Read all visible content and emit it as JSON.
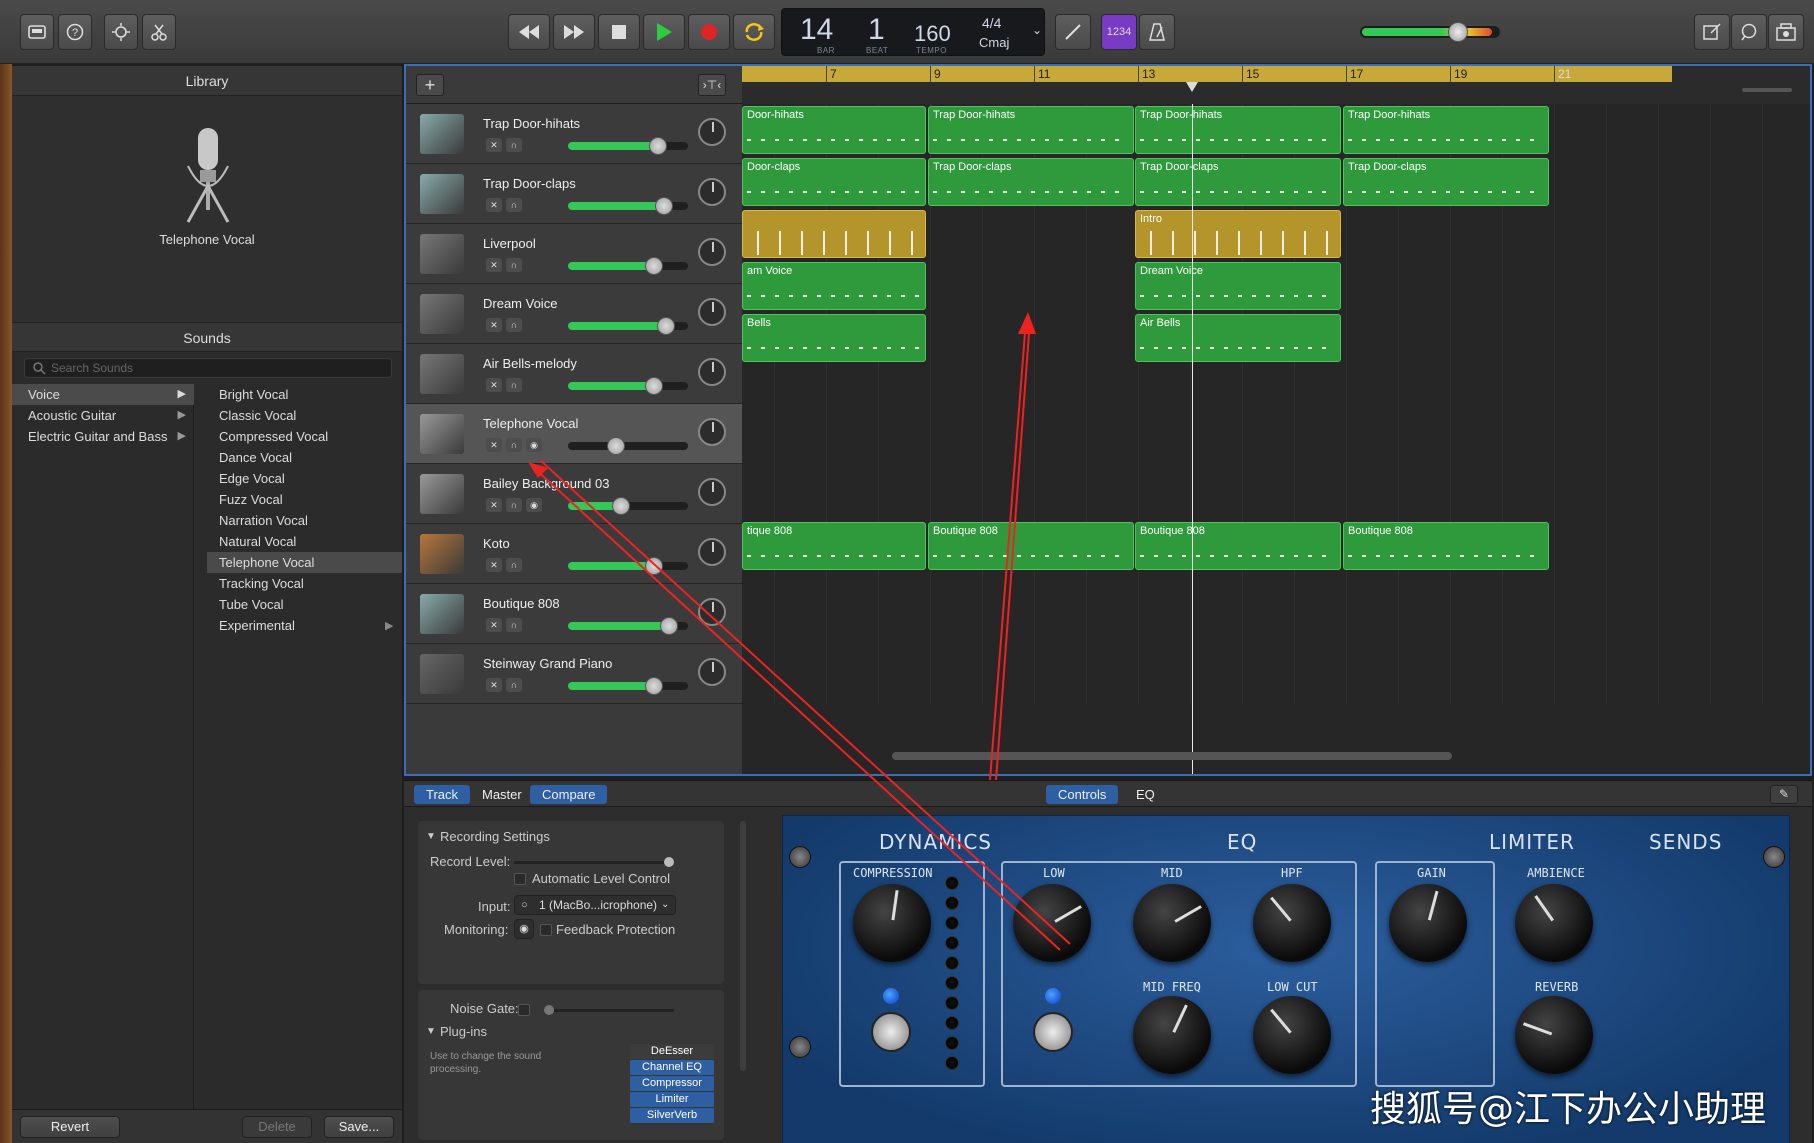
{
  "toolbar": {
    "lcd": {
      "bar": "14",
      "beat": "1",
      "bar_label": "BAR",
      "beat_label": "BEAT",
      "tempo": "160",
      "tempo_label": "TEMPO",
      "signature": "4/4",
      "key": "Cmaj"
    },
    "count_in": "1234",
    "icons": [
      "library-icon",
      "help-icon",
      "smart-controls-icon",
      "scissors-icon",
      "rewind-icon",
      "fast-forward-icon",
      "stop-icon",
      "play-icon",
      "record-icon",
      "cycle-icon",
      "tuner-icon",
      "count-in-icon",
      "metronome-icon",
      "notepad-icon",
      "loops-icon",
      "media-icon"
    ]
  },
  "library": {
    "title": "Library",
    "preview_name": "Telephone Vocal",
    "sounds_header": "Sounds",
    "search_placeholder": "Search Sounds",
    "categories": [
      {
        "label": "Voice",
        "selected": true
      },
      {
        "label": "Acoustic Guitar",
        "selected": false
      },
      {
        "label": "Electric Guitar and Bass",
        "selected": false
      }
    ],
    "patches": [
      {
        "label": "Bright Vocal"
      },
      {
        "label": "Classic Vocal"
      },
      {
        "label": "Compressed Vocal"
      },
      {
        "label": "Dance Vocal"
      },
      {
        "label": "Edge Vocal"
      },
      {
        "label": "Fuzz Vocal"
      },
      {
        "label": "Narration Vocal"
      },
      {
        "label": "Natural Vocal"
      },
      {
        "label": "Telephone Vocal"
      },
      {
        "label": "Tracking Vocal"
      },
      {
        "label": "Tube Vocal"
      },
      {
        "label": "Experimental"
      }
    ],
    "buttons": {
      "revert": "Revert",
      "delete": "Delete",
      "save": "Save..."
    }
  },
  "ruler": {
    "bars": [
      "7",
      "9",
      "11",
      "13",
      "15",
      "17",
      "19",
      "21"
    ]
  },
  "tracks": [
    {
      "name": "Trap Door-hihats",
      "volume": 0.75,
      "selected": false
    },
    {
      "name": "Trap Door-claps",
      "volume": 0.8,
      "selected": false
    },
    {
      "name": "Liverpool",
      "volume": 0.72,
      "selected": false
    },
    {
      "name": "Dream Voice",
      "volume": 0.82,
      "selected": false
    },
    {
      "name": "Air Bells-melody",
      "volume": 0.72,
      "selected": false
    },
    {
      "name": "Telephone Vocal",
      "volume": 0.4,
      "selected": true
    },
    {
      "name": "Bailey Background 03",
      "volume": 0.44,
      "selected": false
    },
    {
      "name": "Koto",
      "volume": 0.72,
      "selected": false
    },
    {
      "name": "Boutique 808",
      "volume": 0.84,
      "selected": false
    },
    {
      "name": "Steinway Grand Piano",
      "volume": 0.72,
      "selected": false
    }
  ],
  "regions": [
    {
      "row": 0,
      "label": "Door-hihats",
      "color": "g"
    },
    {
      "row": 0,
      "label": "Trap Door-hihats",
      "color": "g"
    },
    {
      "row": 0,
      "label": "Trap Door-hihats",
      "color": "g"
    },
    {
      "row": 0,
      "label": "Trap Door-hihats",
      "color": "g"
    },
    {
      "row": 1,
      "label": "Door-claps",
      "color": "g"
    },
    {
      "row": 1,
      "label": "Trap Door-claps",
      "color": "g"
    },
    {
      "row": 1,
      "label": "Trap Door-claps",
      "color": "g"
    },
    {
      "row": 1,
      "label": "Trap Door-claps",
      "color": "g"
    },
    {
      "row": 2,
      "label": "",
      "color": "y"
    },
    {
      "row": 2,
      "label": "Intro",
      "color": "y"
    },
    {
      "row": 3,
      "label": "am Voice",
      "color": "g"
    },
    {
      "row": 3,
      "label": "Dream Voice",
      "color": "g"
    },
    {
      "row": 4,
      "label": "Bells",
      "color": "g"
    },
    {
      "row": 4,
      "label": "Air Bells",
      "color": "g"
    },
    {
      "row": 8,
      "label": "tique 808",
      "color": "g"
    },
    {
      "row": 8,
      "label": "Boutique 808",
      "color": "g"
    },
    {
      "row": 8,
      "label": "Boutique 808",
      "color": "g"
    },
    {
      "row": 8,
      "label": "Boutique 808",
      "color": "g"
    }
  ],
  "editor": {
    "tabs_left": [
      {
        "label": "Track",
        "active": true
      },
      {
        "label": "Master",
        "active": false
      },
      {
        "label": "Compare",
        "active": true
      }
    ],
    "tabs_center": [
      {
        "label": "Controls",
        "active": true
      },
      {
        "label": "EQ",
        "active": false
      }
    ],
    "recording_settings": "Recording Settings",
    "record_level": "Record Level:",
    "auto_level": "Automatic Level Control",
    "input_label": "Input:",
    "input_value": "1  (MacBo...icrophone)",
    "monitoring_label": "Monitoring:",
    "feedback": "Feedback Protection",
    "noise_gate": "Noise Gate:",
    "plugins_header": "Plug-ins",
    "plugins_hint": "Use to change the sound processing.",
    "plugins": [
      "DeEsser",
      "Channel EQ",
      "Compressor",
      "Limiter",
      "SilverVerb"
    ]
  },
  "smart_controls": {
    "sections": [
      "DYNAMICS",
      "EQ",
      "LIMITER",
      "SENDS"
    ],
    "knobs": [
      "COMPRESSION",
      "LOW",
      "MID",
      "HPF",
      "GAIN",
      "AMBIENCE",
      "MID FREQ",
      "LOW CUT",
      "REVERB"
    ]
  },
  "watermark": "搜狐号@江下办公小助理"
}
